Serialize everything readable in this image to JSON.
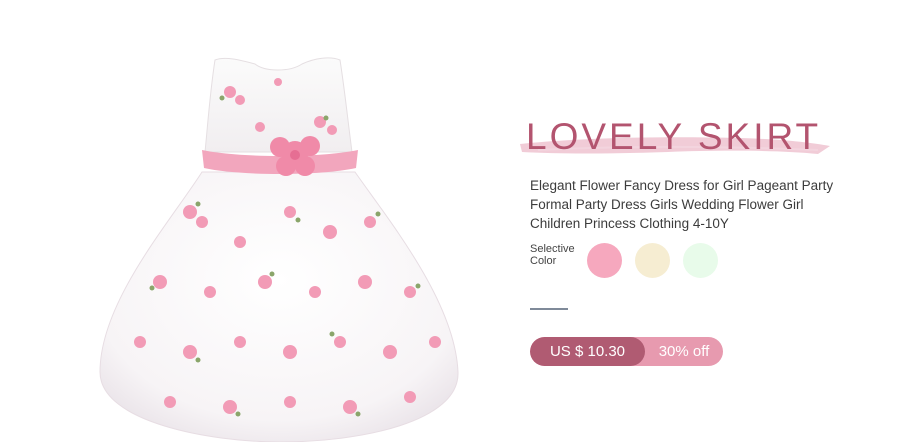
{
  "product": {
    "title": "LOVELY SKIRT",
    "description": "Elegant Flower Fancy Dress for Girl Pageant Party Formal Party Dress Girls Wedding Flower Girl Children Princess Clothing 4-10Y",
    "image_icon": "dress-image"
  },
  "colors": {
    "label_line1": "Selective",
    "label_line2": "Color",
    "swatches": [
      {
        "name": "pink",
        "hex": "#f6a8be"
      },
      {
        "name": "cream",
        "hex": "#f6edd2"
      },
      {
        "name": "mint",
        "hex": "#e8fbea"
      }
    ]
  },
  "price": {
    "current": "US $ 10.30",
    "discount": "30% off"
  },
  "accent": {
    "title": "#b3546f",
    "brush": "#f0c6d3",
    "price_dark": "#b05b72",
    "price_light": "#e79aaf"
  }
}
